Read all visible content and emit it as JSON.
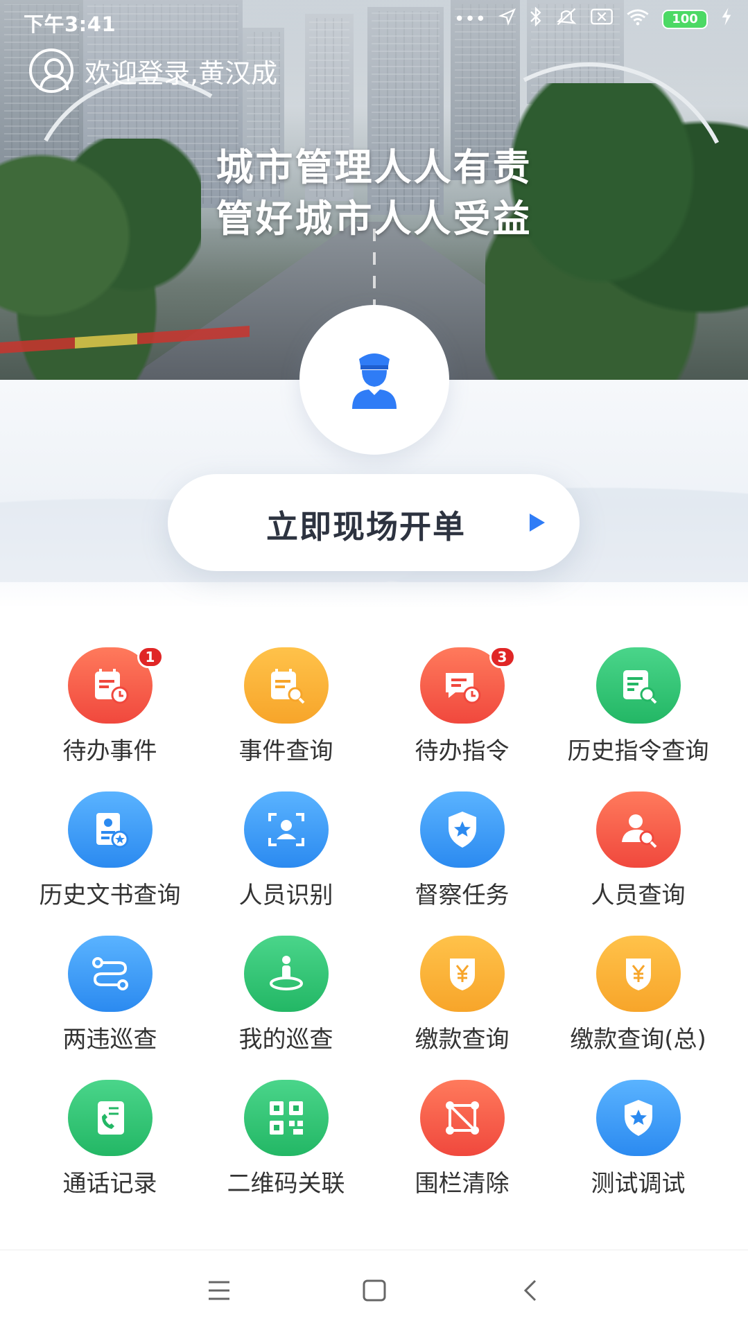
{
  "status_bar": {
    "time": "下午3:41",
    "battery": "100",
    "icons": [
      "more-dots-icon",
      "location-icon",
      "bluetooth-icon",
      "mute-icon",
      "sim-off-icon",
      "wifi-icon",
      "battery-icon",
      "charging-icon"
    ]
  },
  "header": {
    "login_text": "欢迎登录,黄汉成",
    "slogan_line1": "城市管理人人有责",
    "slogan_line2": "管好城市人人受益"
  },
  "primary_action": {
    "label": "立即现场开单"
  },
  "colors": {
    "red": "#f0483d",
    "orange": "#f7a52a",
    "green": "#23b765",
    "blue": "#2b8af0",
    "badge": "#e02626",
    "arrow": "#2f7cf6"
  },
  "grid": {
    "items": [
      {
        "label": "待办事件",
        "icon": "calendar-clock-icon",
        "color": "red",
        "badge": "1"
      },
      {
        "label": "事件查询",
        "icon": "calendar-search-icon",
        "color": "orange",
        "badge": null
      },
      {
        "label": "待办指令",
        "icon": "message-clock-icon",
        "color": "red",
        "badge": "3"
      },
      {
        "label": "历史指令查询",
        "icon": "document-search-icon",
        "color": "green",
        "badge": null
      },
      {
        "label": "历史文书查询",
        "icon": "id-card-star-icon",
        "color": "blue",
        "badge": null
      },
      {
        "label": "人员识别",
        "icon": "face-scan-icon",
        "color": "blue",
        "badge": null
      },
      {
        "label": "督察任务",
        "icon": "shield-star-icon",
        "color": "blue",
        "badge": null
      },
      {
        "label": "人员查询",
        "icon": "person-search-icon",
        "color": "red",
        "badge": null
      },
      {
        "label": "两违巡查",
        "icon": "route-icon",
        "color": "blue",
        "badge": null
      },
      {
        "label": "我的巡查",
        "icon": "person-location-icon",
        "color": "green",
        "badge": null
      },
      {
        "label": "缴款查询",
        "icon": "yen-shield-icon",
        "color": "orange",
        "badge": null
      },
      {
        "label": "缴款查询(总)",
        "icon": "yen-shield-icon",
        "color": "orange",
        "badge": null
      },
      {
        "label": "通话记录",
        "icon": "phone-book-icon",
        "color": "green",
        "badge": null
      },
      {
        "label": "二维码关联",
        "icon": "qr-code-icon",
        "color": "green",
        "badge": null
      },
      {
        "label": "围栏清除",
        "icon": "fence-clear-icon",
        "color": "red",
        "badge": null
      },
      {
        "label": "测试调试",
        "icon": "shield-star-icon",
        "color": "blue",
        "badge": null
      }
    ]
  },
  "navbar": {
    "buttons": [
      "menu-icon",
      "home-icon",
      "back-icon"
    ]
  }
}
